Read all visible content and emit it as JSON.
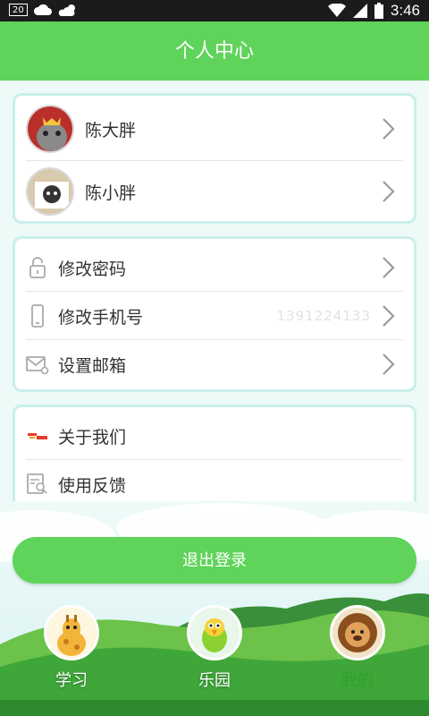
{
  "status_bar": {
    "badge": "20",
    "time": "3:46"
  },
  "header": {
    "title": "个人中心"
  },
  "accounts": [
    {
      "name": "陈大胖"
    },
    {
      "name": "陈小胖"
    }
  ],
  "settings": {
    "change_password": "修改密码",
    "change_phone": "修改手机号",
    "phone_masked": "1391224133",
    "set_email": "设置邮箱"
  },
  "about": {
    "about_us": "关于我们",
    "feedback": "使用反馈"
  },
  "logout_label": "退出登录",
  "tabs": [
    {
      "label": "学习",
      "active": false
    },
    {
      "label": "乐园",
      "active": false
    },
    {
      "label": "我的",
      "active": true
    }
  ],
  "colors": {
    "brand_green": "#5fd35a",
    "card_border": "#c9efe9"
  }
}
